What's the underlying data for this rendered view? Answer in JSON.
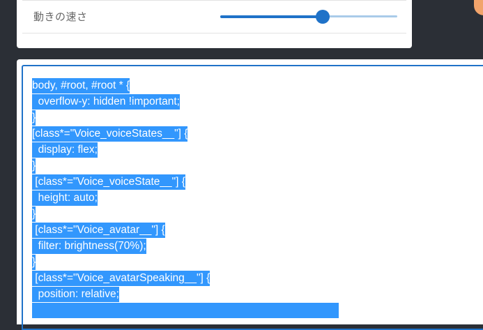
{
  "settings": {
    "motion_speed_label": "動きの速さ",
    "motion_speed_value": 0.58
  },
  "editor": {
    "lines": [
      "body, #root, #root * {",
      "  overflow-y: hidden !important;",
      "}",
      "[class*=\"Voice_voiceStates__\"] {",
      "  display: flex;",
      "}",
      " [class*=\"Voice_voiceState__\"] {",
      "  height: auto;",
      "}",
      " [class*=\"Voice_avatar__\"] {",
      "  filter: brightness(70%);",
      "}",
      " [class*=\"Voice_avatarSpeaking__\"] {",
      "  position: relative;",
      "",
      ""
    ]
  },
  "colors": {
    "accent": "#1f72c8",
    "selection": "#3297fd",
    "background": "#2b2f36"
  }
}
